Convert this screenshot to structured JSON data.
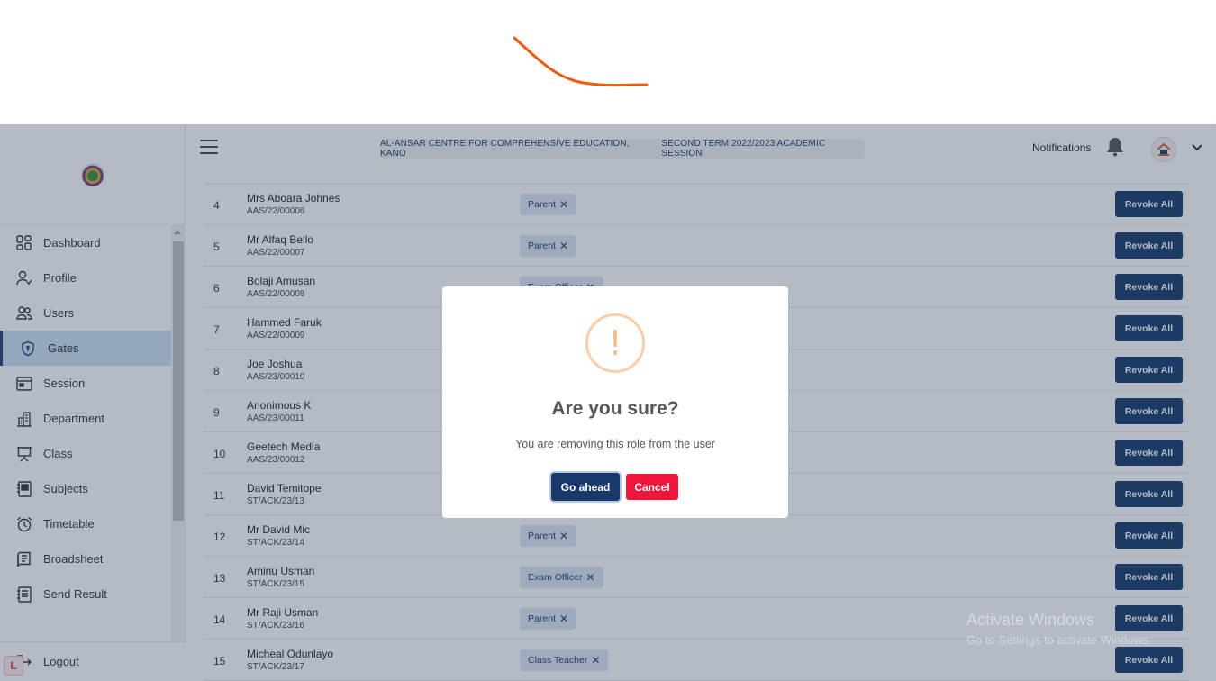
{
  "header": {
    "school_name": "AL-ANSAR CENTRE FOR COMPREHENSIVE EDUCATION, KANO",
    "session": "SECOND TERM 2022/2023 ACADEMIC SESSION",
    "notifications_label": "Notifications"
  },
  "sidebar": {
    "items": [
      {
        "label": "Dashboard",
        "icon": "dashboard-icon"
      },
      {
        "label": "Profile",
        "icon": "user-check-icon"
      },
      {
        "label": "Users",
        "icon": "users-icon"
      },
      {
        "label": "Gates",
        "icon": "shield-icon",
        "active": true
      },
      {
        "label": "Session",
        "icon": "calendar-icon"
      },
      {
        "label": "Department",
        "icon": "building-icon"
      },
      {
        "label": "Class",
        "icon": "presentation-icon"
      },
      {
        "label": "Subjects",
        "icon": "book-icon"
      },
      {
        "label": "Timetable",
        "icon": "alarm-clock-icon"
      },
      {
        "label": "Broadsheet",
        "icon": "spreadsheet-icon"
      },
      {
        "label": "Send Result",
        "icon": "document-icon"
      }
    ],
    "logout_label": "Logout"
  },
  "table": {
    "revoke_label": "Revoke All",
    "rows": [
      {
        "num": "4",
        "name": "Mrs Aboara Johnes",
        "id": "AAS/22/00006",
        "role": "Parent"
      },
      {
        "num": "5",
        "name": "Mr Alfaq Bello",
        "id": "AAS/22/00007",
        "role": "Parent"
      },
      {
        "num": "6",
        "name": "Bolaji Amusan",
        "id": "AAS/22/00008",
        "role": "Exam Officer"
      },
      {
        "num": "7",
        "name": "Hammed Faruk",
        "id": "AAS/22/00009",
        "role": ""
      },
      {
        "num": "8",
        "name": "Joe Joshua",
        "id": "AAS/23/00010",
        "role": ""
      },
      {
        "num": "9",
        "name": "Anonimous K",
        "id": "AAS/23/00011",
        "role": ""
      },
      {
        "num": "10",
        "name": "Geetech Media",
        "id": "AAS/23/00012",
        "role": ""
      },
      {
        "num": "11",
        "name": "David Temitope",
        "id": "ST/ACK/23/13",
        "role": ""
      },
      {
        "num": "12",
        "name": "Mr David Mic",
        "id": "ST/ACK/23/14",
        "role": "Parent"
      },
      {
        "num": "13",
        "name": "Aminu Usman",
        "id": "ST/ACK/23/15",
        "role": "Exam Officer"
      },
      {
        "num": "14",
        "name": "Mr Raji Usman",
        "id": "ST/ACK/23/16",
        "role": "Parent"
      },
      {
        "num": "15",
        "name": "Micheal Odunlayo",
        "id": "ST/ACK/23/17",
        "role": "Class Teacher"
      }
    ]
  },
  "modal": {
    "icon": "!",
    "title": "Are you sure?",
    "text": "You are removing this role from the user",
    "confirm_label": "Go ahead",
    "cancel_label": "Cancel"
  },
  "watermark": {
    "line1": "Activate Windows",
    "line2": "Go to Settings to activate Windows."
  },
  "colors": {
    "primary": "#183a6b",
    "danger": "#f0153a",
    "warning": "#f8bb86",
    "annotation": "#f15a0a"
  }
}
